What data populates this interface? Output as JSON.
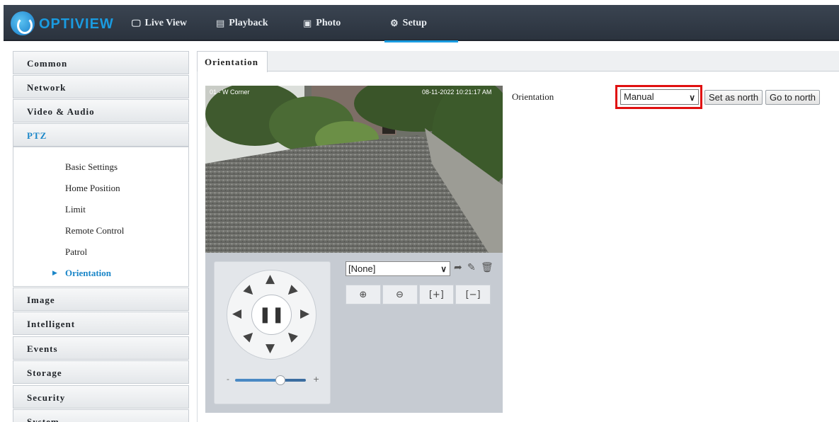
{
  "brand": {
    "logo_text": "OPTIVIEW"
  },
  "topnav": [
    {
      "label": "Live View",
      "icon": "monitor-icon"
    },
    {
      "label": "Playback",
      "icon": "film-icon"
    },
    {
      "label": "Photo",
      "icon": "image-icon"
    },
    {
      "label": "Setup",
      "icon": "gear-icon",
      "active": true
    }
  ],
  "sidebar": {
    "menus_top": [
      "Common",
      "Network",
      "Video & Audio",
      "PTZ"
    ],
    "ptz_items": [
      "Basic Settings",
      "Home Position",
      "Limit",
      "Remote Control",
      "Patrol",
      "Orientation"
    ],
    "ptz_active": "Orientation",
    "menus_bottom": [
      "Image",
      "Intelligent",
      "Events",
      "Storage",
      "Security",
      "System"
    ]
  },
  "tab": {
    "label": "Orientation"
  },
  "video": {
    "overlay_left": "01 - W Corner",
    "overlay_right": "08-11-2022 10:21:17 AM"
  },
  "ptz_panel": {
    "preset_value": "[None]",
    "slider_min": "-",
    "slider_max": "+",
    "speed_level": 0.7
  },
  "orientation": {
    "label": "Orientation",
    "mode_value": "Manual",
    "set_north_label": "Set as north",
    "go_north_label": "Go to north"
  },
  "colors": {
    "accent": "#1a86c8",
    "topbar": "#333c47",
    "highlight_box": "#e01010"
  }
}
